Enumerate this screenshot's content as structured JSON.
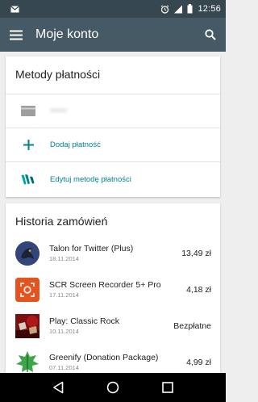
{
  "status_bar": {
    "time": "12:56",
    "icons": [
      "mail-icon",
      "alarm-icon",
      "signal-icon",
      "battery-icon"
    ]
  },
  "app_bar": {
    "title": "Moje konto",
    "icons": [
      "menu-icon",
      "search-icon"
    ]
  },
  "payment_methods": {
    "title": "Metody płatności",
    "items": [
      {
        "label": "••••••",
        "icon": "card-icon"
      },
      {
        "label": "Dodaj płatność",
        "icon": "plus-icon"
      },
      {
        "label": "Edytuj metodę płatności",
        "icon": "wallet-icon"
      }
    ]
  },
  "order_history": {
    "title": "Historia zamówień",
    "orders": [
      {
        "name": "Talon for Twitter (Plus)",
        "date": "18.11.2014",
        "price": "13,49 zł",
        "icon": "talon-app-icon"
      },
      {
        "name": "SCR Screen Recorder 5+ Pro",
        "date": "17.11.2014",
        "price": "4,18 zł",
        "icon": "scr-app-icon"
      },
      {
        "name": "Play: Classic Rock",
        "date": "10.11.2014",
        "price": "Bezpłatne",
        "icon": "classic-rock-album-icon"
      },
      {
        "name": "Greenify (Donation Package)",
        "date": "07.11.2014",
        "price": "4,99 zł",
        "icon": "greenify-app-icon"
      }
    ]
  },
  "nav_bar": {
    "icons": [
      "back-icon",
      "home-icon",
      "recents-icon"
    ]
  },
  "colors": {
    "status_bar": "#37474f",
    "app_bar": "#455a64",
    "accent": "#00838f",
    "background": "#eeeeee"
  }
}
